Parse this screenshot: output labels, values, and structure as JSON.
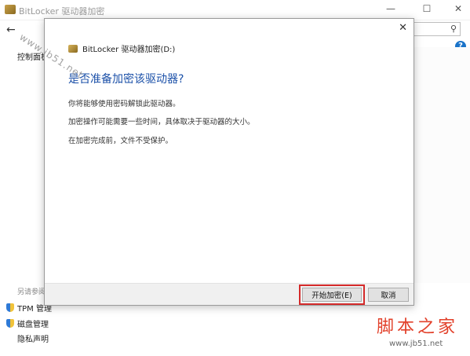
{
  "background_window": {
    "title": "BitLocker 驱动器加密",
    "back_glyph": "←",
    "minimize_glyph": "—",
    "maximize_glyph": "☐",
    "close_glyph": "✕",
    "search_icon_glyph": "⚲",
    "help_glyph": "?",
    "sidebar_top": "控制面板",
    "see_also": "另请参阅",
    "sidebar_items": [
      {
        "label": "TPM 管理"
      },
      {
        "label": "磁盘管理"
      },
      {
        "label": "隐私声明"
      }
    ]
  },
  "dialog": {
    "close_glyph": "✕",
    "header_title": "BitLocker 驱动器加密(D:)",
    "heading": "是否准备加密该驱动器?",
    "paragraphs": [
      "你将能够使用密码解锁此驱动器。",
      "加密操作可能需要一些时间，具体取决于驱动器的大小。",
      "在加密完成前，文件不受保护。"
    ],
    "start_button": "开始加密(E)",
    "cancel_button": "取消"
  },
  "watermark": {
    "diagonal": "www.jb51.net",
    "brand": "脚本之家",
    "url": "www.jb51.net"
  },
  "colors": {
    "heading": "#1b50a8",
    "highlight_box": "#d42a2a",
    "brand": "#e2402a"
  }
}
